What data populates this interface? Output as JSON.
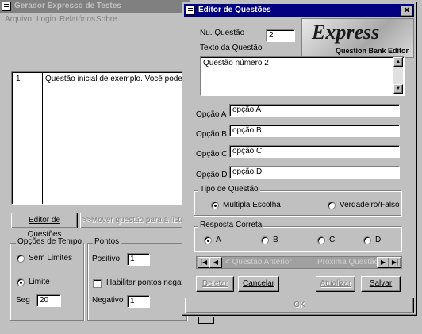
{
  "main_window": {
    "title": "Gerador Expresso de Testes",
    "menu": [
      "Arquivo",
      "Login",
      "Relatórios",
      "Sobre"
    ],
    "list_row": {
      "number": "1",
      "text": "Questão inicial de exemplo. Você pode excu"
    },
    "editor_button": "Editor de Questões",
    "move_button": ">>Mover questão para a lista",
    "time_group": {
      "title": "Opções de Tempo",
      "no_limit": "Sem Limites",
      "limit": "Limite",
      "seg_label": "Seg",
      "seg_value": "20"
    },
    "points_group": {
      "title": "Pontos",
      "positive_label": "Positivo",
      "positive_value": "1",
      "negative_checkbox": "Habilitar pontos negativos",
      "negative_label": "Negativo",
      "negative_value": "1"
    }
  },
  "editor": {
    "title": "Editor de Questões",
    "num_label": "Nu. Questão",
    "num_value": "2",
    "text_label": "Texto da Questão",
    "question_text": "Questão número 2",
    "logo_big": "Express",
    "logo_small": "Question Bank Editor",
    "options": [
      {
        "label": "Opção A",
        "value": "opção A"
      },
      {
        "label": "Opção B",
        "value": "opção B"
      },
      {
        "label": "Opção C",
        "value": "opção C"
      },
      {
        "label": "Opção D",
        "value": "opção D"
      }
    ],
    "type_group": {
      "title": "Tipo de Questão",
      "multiple": "Multipla Escolha",
      "truefalse": "Verdadeiro/Falso"
    },
    "answer_group": {
      "title": "Resposta Correta",
      "choices": [
        "A",
        "B",
        "C",
        "D"
      ]
    },
    "nav": {
      "prev_text": "< Questão Anterior",
      "next_text": "Próxima Questão >"
    },
    "buttons": {
      "delete": "Deletar",
      "cancel": "Cancelar",
      "update": "Atualizar",
      "save": "Salvar",
      "ok": "OK"
    },
    "accent": "#000080"
  }
}
